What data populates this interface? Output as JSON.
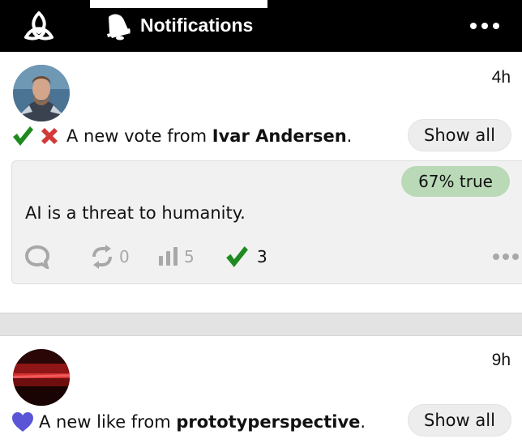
{
  "header": {
    "title": "Notifications",
    "logo_icon": "triquetra-logo-icon",
    "bell_icon": "bell-icon",
    "more_icon": "more-horizontal-icon"
  },
  "notifications": [
    {
      "type": "vote",
      "time": "4h",
      "icons": [
        "check-icon",
        "cross-icon"
      ],
      "text_prefix": "A new vote from ",
      "actor": "Ivar Andersen",
      "text_suffix": ".",
      "show_all_label": "Show all",
      "post": {
        "truth_badge": "67% true",
        "text": "AI is a threat to humanity.",
        "actions": {
          "comment_icon": "comment-icon",
          "reposts": "0",
          "views": "5",
          "true_votes": "3"
        }
      }
    },
    {
      "type": "like",
      "time": "9h",
      "icons": [
        "heart-icon"
      ],
      "text_prefix": "A new like from ",
      "actor": "prototyperspective",
      "text_suffix": ".",
      "show_all_label": "Show all"
    }
  ],
  "colors": {
    "header_bg": "#000000",
    "check_green": "#1f8a1f",
    "cross_red": "#d23a3a",
    "heart_blue": "#5a55d6",
    "truth_badge_bg": "#b9d9b7",
    "post_bg": "#f1f1f1"
  }
}
